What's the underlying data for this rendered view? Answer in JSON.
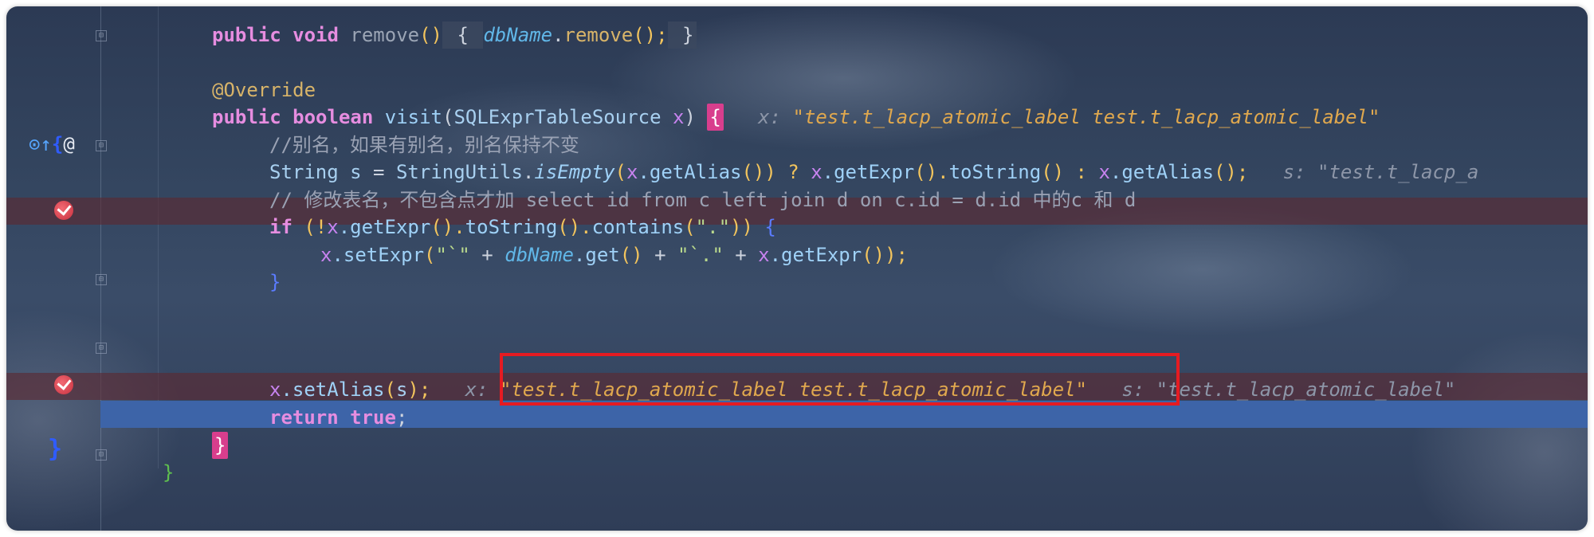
{
  "editor": {
    "lines": {
      "remove": {
        "kw": "public void ",
        "name": "remove",
        "parens": "()",
        "open": " { ",
        "field": "dbName",
        "dot": ".",
        "call": "remove",
        "callp": "();",
        "close": " }"
      },
      "override": {
        "text": "@Override"
      },
      "visit": {
        "kw": "public boolean ",
        "name": "visit",
        "open": "(",
        "type": "SQLExprTableSource",
        "space": " ",
        "param": "x",
        "close": ") ",
        "brace": "{",
        "hint_label": "x: ",
        "hint_value": "\"test.t_lacp_atomic_label test.t_lacp_atomic_label\""
      },
      "comment1": {
        "text": "//别名，如果有别名，别名保持不变"
      },
      "string_s": {
        "type": "String ",
        "var": "s",
        "eq": " = ",
        "cls": "StringUtils",
        "dot1": ".",
        "static": "isEmpty",
        "p1": "(",
        "x1": "x",
        "get1": ".getAlias",
        "p2": "()) ? ",
        "x2": "x",
        "get2": ".getExpr",
        "p3": "().",
        "ts": "toString",
        "p4": "() : ",
        "x3": "x",
        "get3": ".getAlias",
        "p5": "();",
        "hint": "s: \"test.t_lacp_a"
      },
      "comment2": {
        "text": "// 修改表名，不包含点才加 select id from c left join d on c.id = d.id 中的c 和 d"
      },
      "if_line": {
        "kw": "if ",
        "open": "(!",
        "x": "x",
        "m1": ".getExpr",
        "p1": "().",
        "m2": "toString",
        "p2": "().",
        "m3": "contains",
        "p3": "(",
        "s": "\".\"",
        "p4": ")) ",
        "brace": "{"
      },
      "setexpr": {
        "x": "x",
        "m": ".setExpr",
        "p1": "(",
        "s1": "\"`\"",
        "plus1": " + ",
        "field": "dbName",
        "get": ".get",
        "p2": "()",
        "plus2": " + ",
        "s2": "\"`.\"",
        "plus3": " + ",
        "x2": "x",
        "m2": ".getExpr",
        "p3": "());"
      },
      "close_if": {
        "text": "}"
      },
      "setalias": {
        "x": "x",
        "m": ".setAlias",
        "p1": "(",
        "s": "s",
        "p2": ");",
        "hint_label": "x: ",
        "hint_value": "\"test.t_lacp_atomic_label test.t_lacp_atomic_label\"",
        "hint2": "s: \"test.t_lacp_atomic_label\""
      },
      "return": {
        "kw": "return ",
        "val": "true",
        "semi": ";"
      },
      "close_method": {
        "text": "}"
      },
      "close_class": {
        "text": "}"
      }
    },
    "gutter": {
      "override_icons": "⊙↑",
      "at_icon": "@",
      "class_brace": "}"
    }
  }
}
